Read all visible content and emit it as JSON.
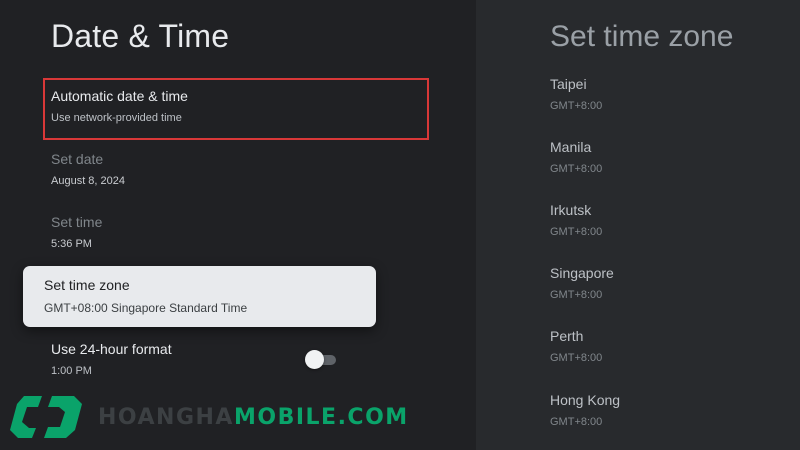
{
  "left": {
    "title": "Date & Time",
    "items": [
      {
        "title": "Automatic date & time",
        "subtitle": "Use network-provided time"
      },
      {
        "title": "Set date",
        "subtitle": "August 8, 2024"
      },
      {
        "title": "Set time",
        "subtitle": "5:36 PM"
      },
      {
        "title": "Set time zone",
        "subtitle": "GMT+08:00 Singapore Standard Time"
      },
      {
        "title": "Use 24-hour format",
        "subtitle": "1:00 PM",
        "toggle_on": false
      }
    ]
  },
  "right": {
    "title": "Set time zone",
    "zones": [
      {
        "name": "Taipei",
        "offset": "GMT+8:00"
      },
      {
        "name": "Manila",
        "offset": "GMT+8:00"
      },
      {
        "name": "Irkutsk",
        "offset": "GMT+8:00"
      },
      {
        "name": "Singapore",
        "offset": "GMT+8:00"
      },
      {
        "name": "Perth",
        "offset": "GMT+8:00"
      },
      {
        "name": "Hong Kong",
        "offset": "GMT+8:00"
      }
    ]
  },
  "watermark": {
    "part1": "HOANGHA",
    "part2": "MOBILE.COM"
  },
  "colors": {
    "background": "#202124",
    "panel": "#282a2d",
    "focus_card": "#e8eaed",
    "highlight_border": "#d93838",
    "watermark_accent": "#0aa36a"
  }
}
